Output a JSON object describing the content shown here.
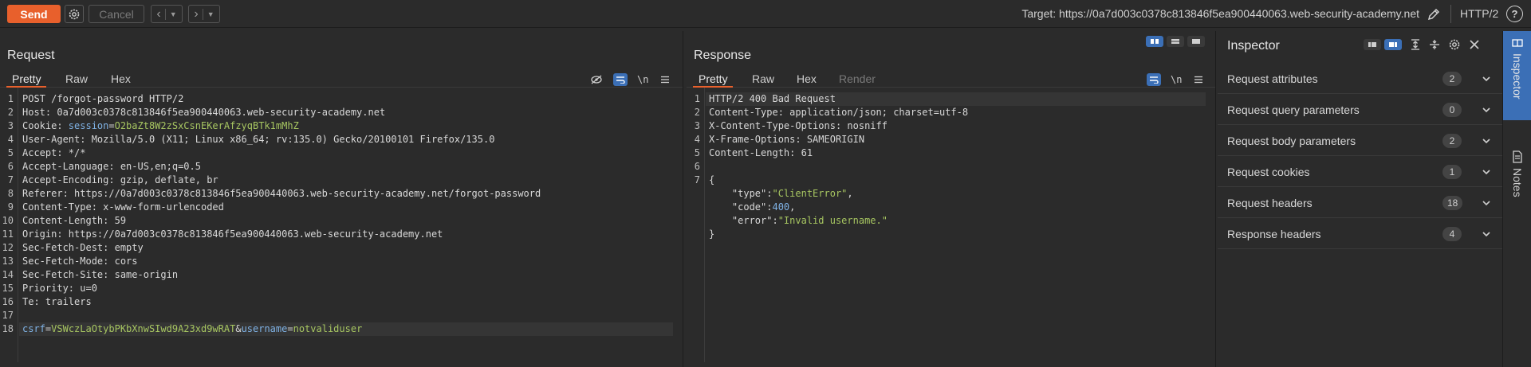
{
  "toolbar": {
    "send_label": "Send",
    "cancel_label": "Cancel",
    "target": "Target: https://0a7d003c0378c813846f5ea900440063.web-security-academy.net",
    "protocol": "HTTP/2",
    "help_label": "?"
  },
  "request": {
    "title": "Request",
    "tabs": [
      "Pretty",
      "Raw",
      "Hex"
    ],
    "newline_toggle": "\\n",
    "lines": [
      {
        "n": "1",
        "parts": [
          {
            "t": "POST /forgot-password HTTP/2",
            "c": ""
          }
        ]
      },
      {
        "n": "2",
        "parts": [
          {
            "t": "Host: ",
            "c": ""
          },
          {
            "t": "0a7d003c0378c813846f5ea900440063.web-security-academy.net",
            "c": ""
          }
        ]
      },
      {
        "n": "3",
        "parts": [
          {
            "t": "Cookie: ",
            "c": ""
          },
          {
            "t": "session",
            "c": "k-blue"
          },
          {
            "t": "=",
            "c": ""
          },
          {
            "t": "O2baZt8W2zSxCsnEKerAfzyqBTk1mMhZ",
            "c": "k-green"
          }
        ]
      },
      {
        "n": "4",
        "parts": [
          {
            "t": "User-Agent: Mozilla/5.0 (X11; Linux x86_64; rv:135.0) Gecko/20100101 Firefox/135.0",
            "c": ""
          }
        ]
      },
      {
        "n": "5",
        "parts": [
          {
            "t": "Accept: */*",
            "c": ""
          }
        ]
      },
      {
        "n": "6",
        "parts": [
          {
            "t": "Accept-Language: en-US,en;q=0.5",
            "c": ""
          }
        ]
      },
      {
        "n": "7",
        "parts": [
          {
            "t": "Accept-Encoding: gzip, deflate, br",
            "c": ""
          }
        ]
      },
      {
        "n": "8",
        "parts": [
          {
            "t": "Referer: https://0a7d003c0378c813846f5ea900440063.web-security-academy.net/forgot-password",
            "c": ""
          }
        ]
      },
      {
        "n": "9",
        "parts": [
          {
            "t": "Content-Type: x-www-form-urlencoded",
            "c": ""
          }
        ]
      },
      {
        "n": "10",
        "parts": [
          {
            "t": "Content-Length: 59",
            "c": ""
          }
        ]
      },
      {
        "n": "11",
        "parts": [
          {
            "t": "Origin: https://0a7d003c0378c813846f5ea900440063.web-security-academy.net",
            "c": ""
          }
        ]
      },
      {
        "n": "12",
        "parts": [
          {
            "t": "Sec-Fetch-Dest: empty",
            "c": ""
          }
        ]
      },
      {
        "n": "13",
        "parts": [
          {
            "t": "Sec-Fetch-Mode: cors",
            "c": ""
          }
        ]
      },
      {
        "n": "14",
        "parts": [
          {
            "t": "Sec-Fetch-Site: same-origin",
            "c": ""
          }
        ]
      },
      {
        "n": "15",
        "parts": [
          {
            "t": "Priority: u=0",
            "c": ""
          }
        ]
      },
      {
        "n": "16",
        "parts": [
          {
            "t": "Te: trailers",
            "c": ""
          }
        ]
      },
      {
        "n": "17",
        "parts": []
      },
      {
        "n": "18",
        "hl": true,
        "parts": [
          {
            "t": "csrf",
            "c": "k-blue"
          },
          {
            "t": "=",
            "c": ""
          },
          {
            "t": "VSWczLaOtybPKbXnwSIwd9A23xd9wRAT",
            "c": "k-green"
          },
          {
            "t": "&",
            "c": ""
          },
          {
            "t": "username",
            "c": "k-blue"
          },
          {
            "t": "=",
            "c": ""
          },
          {
            "t": "notvaliduser",
            "c": "k-green"
          }
        ]
      }
    ]
  },
  "response": {
    "title": "Response",
    "tabs": [
      "Pretty",
      "Raw",
      "Hex",
      "Render"
    ],
    "newline_toggle": "\\n",
    "lines": [
      {
        "n": "1",
        "hl": true,
        "parts": [
          {
            "t": "HTTP/2 400 Bad Request",
            "c": ""
          }
        ]
      },
      {
        "n": "2",
        "parts": [
          {
            "t": "Content-Type: application/json; charset=utf-8",
            "c": ""
          }
        ]
      },
      {
        "n": "3",
        "parts": [
          {
            "t": "X-Content-Type-Options: nosniff",
            "c": ""
          }
        ]
      },
      {
        "n": "4",
        "parts": [
          {
            "t": "X-Frame-Options: SAMEORIGIN",
            "c": ""
          }
        ]
      },
      {
        "n": "5",
        "parts": [
          {
            "t": "Content-Length: 61",
            "c": ""
          }
        ]
      },
      {
        "n": "6",
        "parts": []
      },
      {
        "n": "7",
        "parts": [
          {
            "t": "{",
            "c": ""
          }
        ]
      },
      {
        "n": "",
        "parts": [
          {
            "t": "    \"type\":",
            "c": ""
          },
          {
            "t": "\"ClientError\"",
            "c": "k-str"
          },
          {
            "t": ",",
            "c": ""
          }
        ]
      },
      {
        "n": "",
        "parts": [
          {
            "t": "    \"code\":",
            "c": ""
          },
          {
            "t": "400",
            "c": "k-num"
          },
          {
            "t": ",",
            "c": ""
          }
        ]
      },
      {
        "n": "",
        "parts": [
          {
            "t": "    \"error\":",
            "c": ""
          },
          {
            "t": "\"Invalid username.\"",
            "c": "k-str"
          }
        ]
      },
      {
        "n": "",
        "parts": [
          {
            "t": "}",
            "c": ""
          }
        ]
      }
    ]
  },
  "inspector": {
    "title": "Inspector",
    "rows": [
      {
        "label": "Request attributes",
        "count": "2"
      },
      {
        "label": "Request query parameters",
        "count": "0"
      },
      {
        "label": "Request body parameters",
        "count": "2"
      },
      {
        "label": "Request cookies",
        "count": "1"
      },
      {
        "label": "Request headers",
        "count": "18"
      },
      {
        "label": "Response headers",
        "count": "4"
      }
    ]
  },
  "sidebar": {
    "tabs": [
      "Inspector",
      "Notes"
    ]
  },
  "colors": {
    "accent": "#e8602c",
    "selected": "#3b6fb6",
    "string": "#a7c661",
    "param": "#7fb2e5"
  }
}
